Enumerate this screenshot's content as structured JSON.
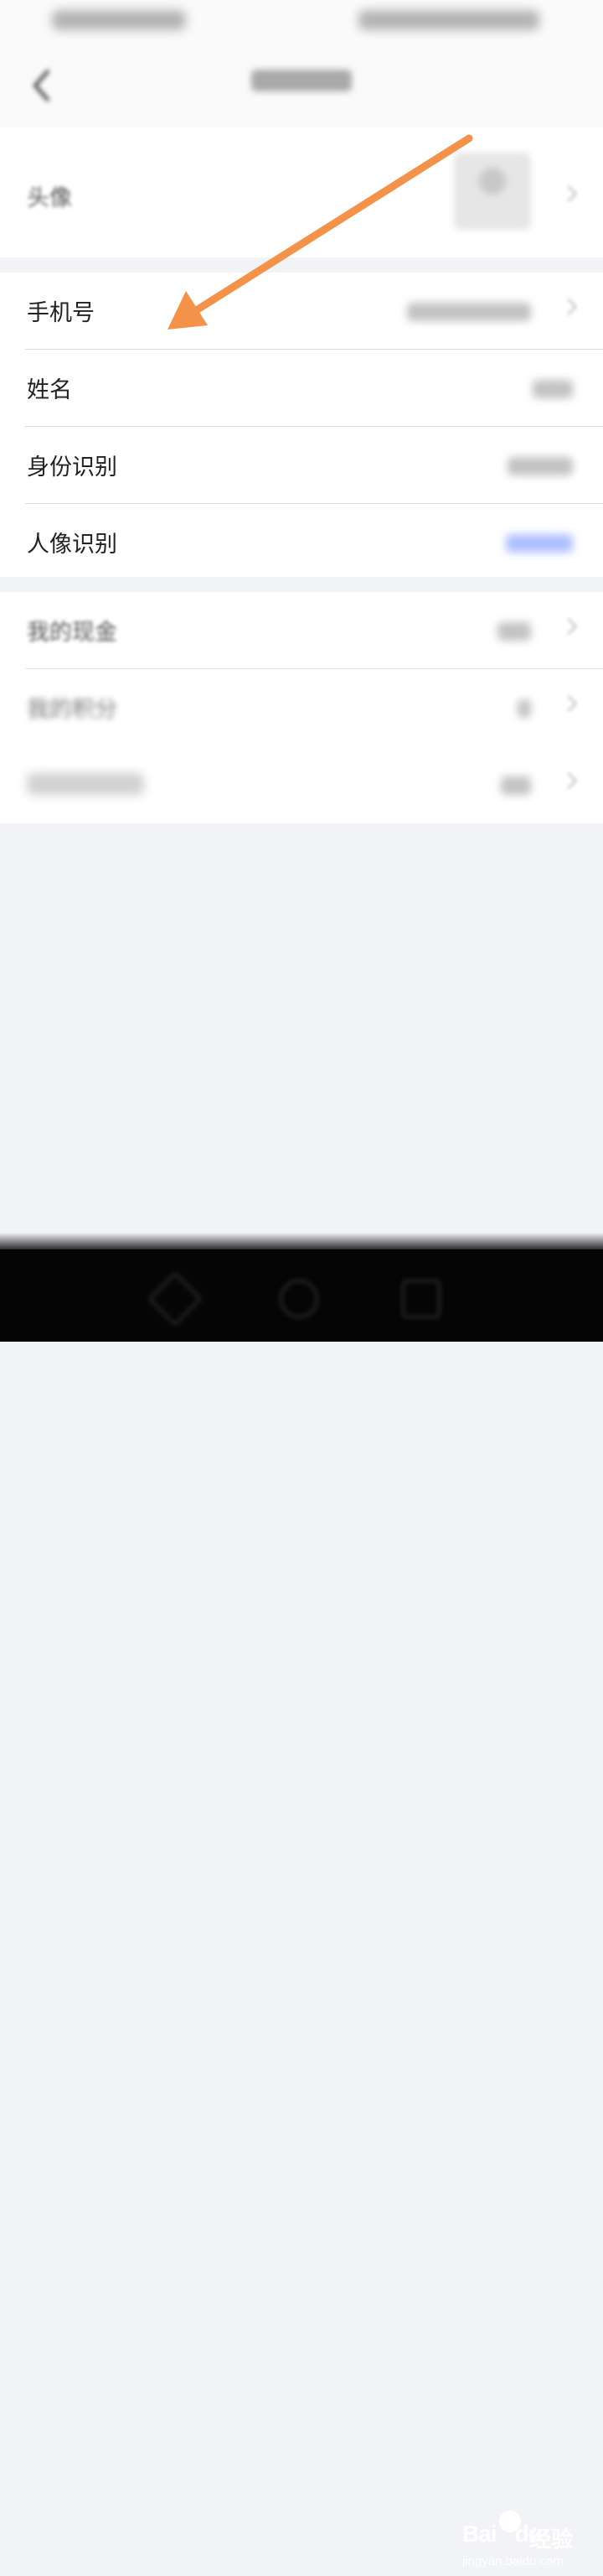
{
  "status_bar": {},
  "nav": {
    "title": ""
  },
  "profile": {
    "avatar_label": "头像"
  },
  "info": {
    "rows": [
      {
        "label": "手机号"
      },
      {
        "label": "姓名"
      },
      {
        "label": "身份识别"
      },
      {
        "label": "人像识别"
      }
    ]
  },
  "assets": {
    "rows": [
      {
        "label": "我的现金"
      },
      {
        "label": "我的积分"
      }
    ]
  },
  "watermark": {
    "logo": "Bai",
    "logo_tail": "du",
    "brand": "经验",
    "url": "jingyan.baidu.com"
  },
  "colors": {
    "arrow": "#f5924a",
    "page_bg": "#f2f3f7",
    "link_blue": "#6e8cff"
  }
}
